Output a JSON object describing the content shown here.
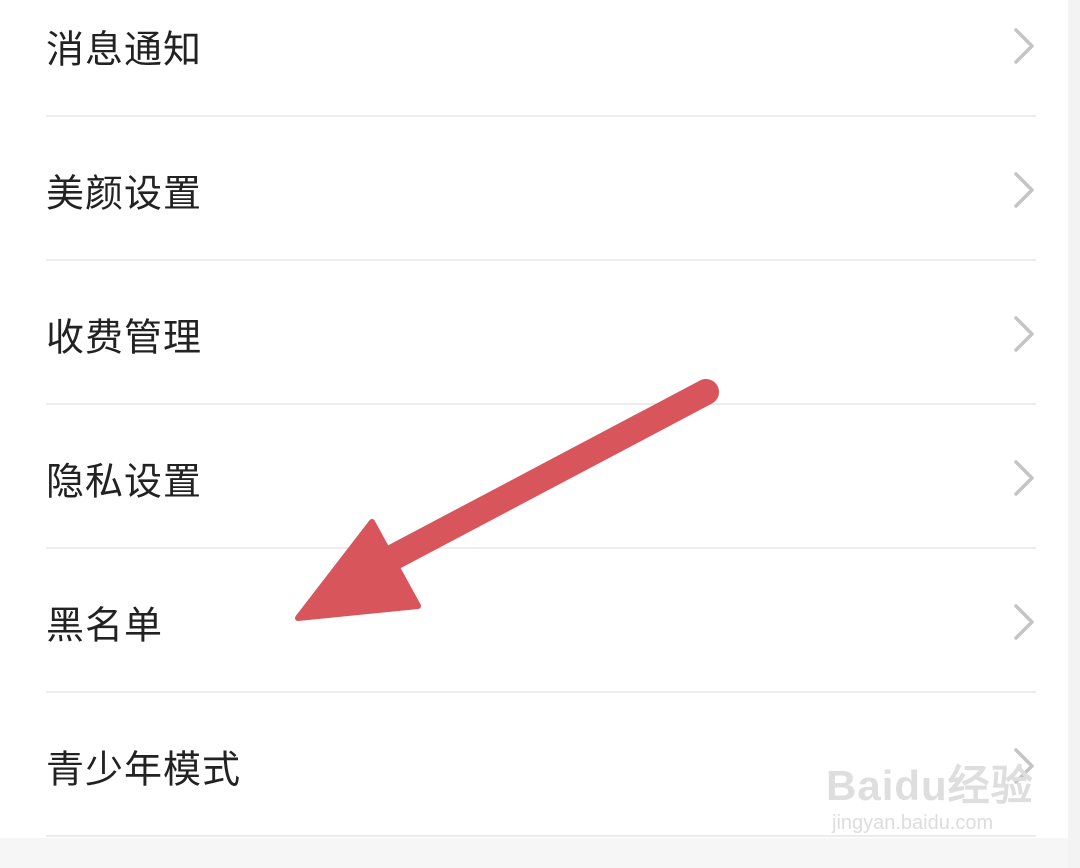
{
  "settings": {
    "items": [
      {
        "label": "消息通知"
      },
      {
        "label": "美颜设置"
      },
      {
        "label": "收费管理"
      },
      {
        "label": "隐私设置"
      },
      {
        "label": "黑名单"
      },
      {
        "label": "青少年模式"
      }
    ],
    "chevron_icon": "chevron-right-icon"
  },
  "annotation": {
    "type": "arrow",
    "color": "#d9555c",
    "points_to": "黑名单"
  },
  "watermark": {
    "logo": "Baidu经验",
    "url": "jingyan.baidu.com"
  },
  "colors": {
    "background": "#ffffff",
    "text": "#222222",
    "divider": "#ececec",
    "chevron": "#c4c4c4"
  }
}
